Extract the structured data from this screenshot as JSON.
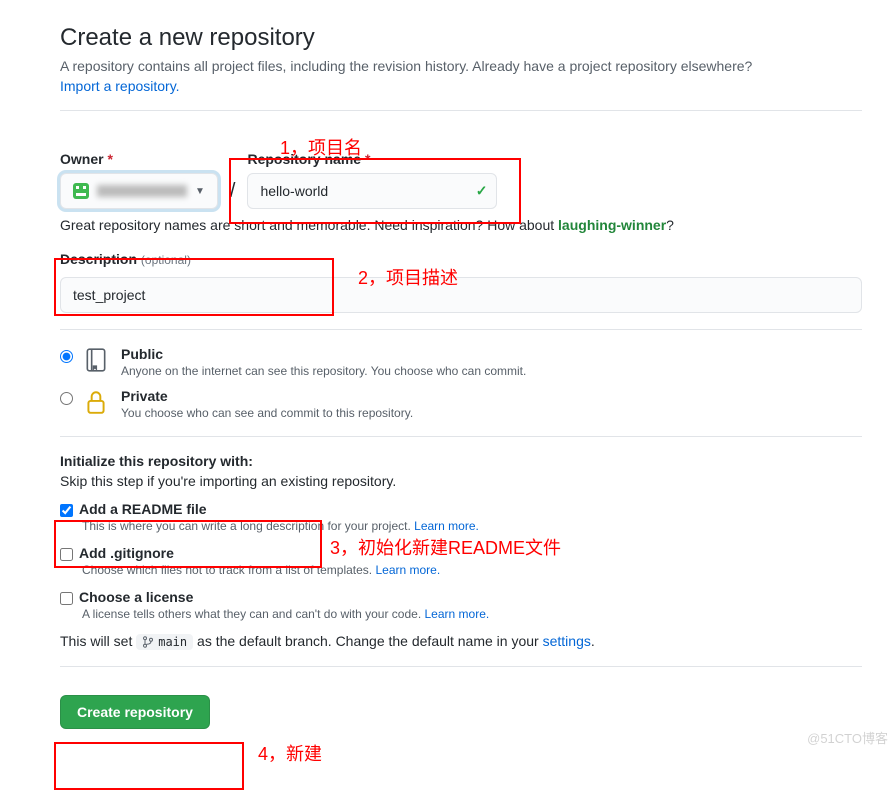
{
  "header": {
    "title": "Create a new repository",
    "subtitle": "A repository contains all project files, including the revision history. Already have a project repository elsewhere?",
    "import_link": "Import a repository."
  },
  "owner": {
    "label": "Owner"
  },
  "repo": {
    "label": "Repository name",
    "value": "hello-world"
  },
  "hint": {
    "prefix": "Great repository names are short and memorable. Need inspiration? How about ",
    "suggestion": "laughing-winner",
    "suffix": "?"
  },
  "description": {
    "label": "Description",
    "optional": "(optional)",
    "value": "test_project"
  },
  "visibility": {
    "public": {
      "title": "Public",
      "desc": "Anyone on the internet can see this repository. You choose who can commit."
    },
    "private": {
      "title": "Private",
      "desc": "You choose who can see and commit to this repository."
    }
  },
  "init": {
    "title": "Initialize this repository with:",
    "sub": "Skip this step if you're importing an existing repository."
  },
  "readme": {
    "title": "Add a README file",
    "desc": "This is where you can write a long description for your project. ",
    "link": "Learn more."
  },
  "gitignore": {
    "title": "Add .gitignore",
    "desc": "Choose which files not to track from a list of templates. ",
    "link": "Learn more."
  },
  "license": {
    "title": "Choose a license",
    "desc": "A license tells others what they can and can't do with your code. ",
    "link": "Learn more."
  },
  "branch": {
    "prefix": "This will set ",
    "name": "main",
    "mid": " as the default branch. Change the default name in your ",
    "link": "settings",
    "suffix": "."
  },
  "button": {
    "create": "Create repository"
  },
  "annot": {
    "a1": "1，项目名",
    "a2": "2，项目描述",
    "a3": "3，初始化新建README文件",
    "a4": "4，新建"
  },
  "watermark": "@51CTO博客"
}
